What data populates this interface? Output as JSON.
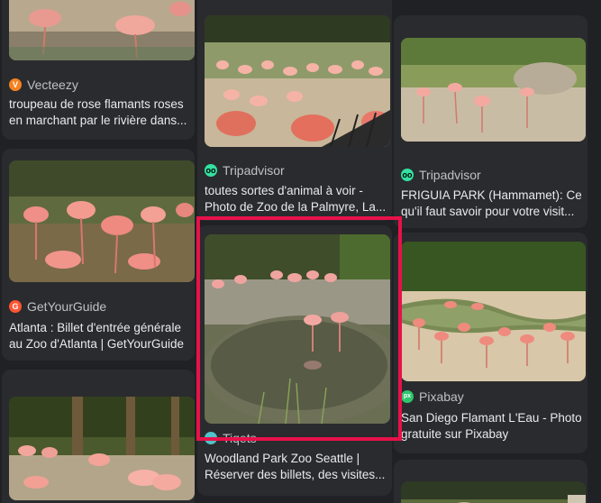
{
  "results": [
    {
      "source": "Vecteezy",
      "title_lines": [
        "troupeau de rose flamants roses",
        "en marchant par le rivière dans..."
      ],
      "favicon_color": "#f5821f",
      "favicon_glyph": "V"
    },
    {
      "source": "GetYourGuide",
      "title_lines": [
        "Atlanta : Billet d'entrée générale",
        "au Zoo d'Atlanta | GetYourGuide"
      ],
      "favicon_color": "#ff5533",
      "favicon_glyph": "G"
    },
    {
      "source": "Tripadvisor",
      "title_lines": [
        "toutes sortes d'animal à voir -",
        "Photo de Zoo de la Palmyre, La..."
      ],
      "favicon_color": "#34e0a1",
      "favicon_glyph": "oo"
    },
    {
      "source": "Tiqets",
      "title_lines": [
        "Woodland Park Zoo Seattle |",
        "Réserver des billets, des visites..."
      ],
      "favicon_color": "#4fc3c9",
      "favicon_glyph": ""
    },
    {
      "source": "Tripadvisor",
      "title_lines": [
        "FRIGUIA PARK (Hammamet): Ce",
        "qu'il faut savoir pour votre visit..."
      ],
      "favicon_color": "#34e0a1",
      "favicon_glyph": "oo"
    },
    {
      "source": "Pixabay",
      "title_lines": [
        "San Diego Flamant L'Eau - Photo",
        "gratuite sur Pixabay"
      ],
      "favicon_color": "#2ec66d",
      "favicon_glyph": "px"
    }
  ],
  "colors": {
    "background": "#202124",
    "card": "#2a2b2e",
    "highlight": "#e8114a"
  }
}
